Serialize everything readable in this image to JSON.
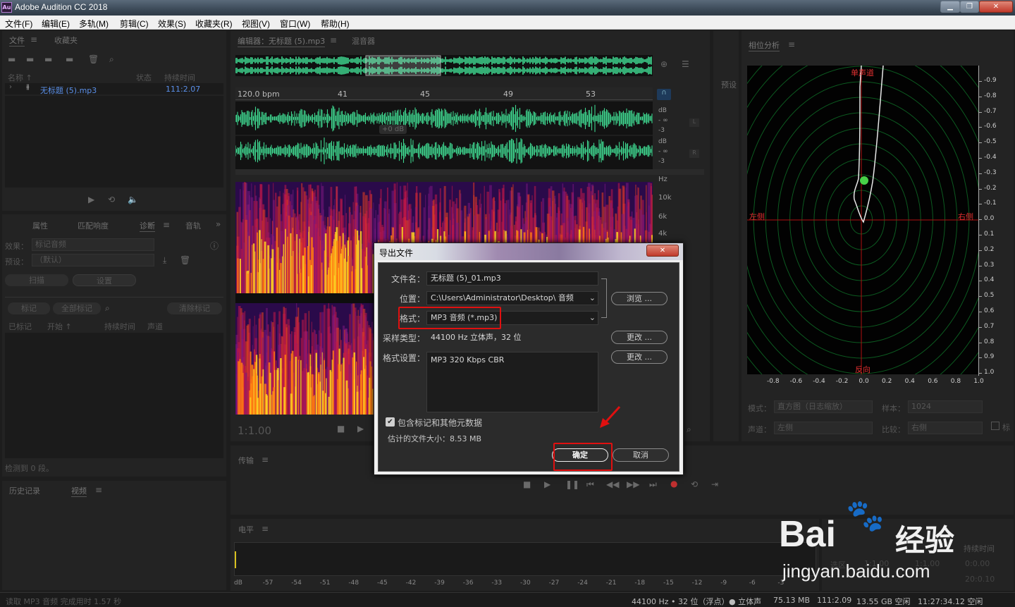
{
  "window": {
    "title": "Adobe Audition CC 2018",
    "icon_text": "Au",
    "min": "▁",
    "restore": "❐",
    "close": "✕"
  },
  "menu": [
    "文件(F)",
    "编辑(E)",
    "多轨(M)",
    "剪辑(C)",
    "效果(S)",
    "收藏夹(R)",
    "视图(V)",
    "窗口(W)",
    "帮助(H)"
  ],
  "files_panel": {
    "tabs": [
      "文件",
      "收藏夹"
    ],
    "columns": [
      "名称 ↑",
      "状态",
      "持续时间"
    ],
    "file_name": "无标题 (5).mp3",
    "file_duration": "111:2.07"
  },
  "diagnostics_panel": {
    "tabs": [
      "属性",
      "匹配响度",
      "诊断",
      "音轨"
    ],
    "effect_label": "效果：",
    "effect_value": "标记音频",
    "preset_label": "预设：",
    "preset_value": "（默认）",
    "scan": "扫描",
    "settings": "设置",
    "mark": "标记",
    "mark_all": "全部标记",
    "clear_marks": "清除标记",
    "cols": [
      "已标记",
      "开始 ↑",
      "持续时间",
      "声道"
    ],
    "detected": "检测到 0 段。"
  },
  "history_panel": {
    "tabs": [
      "历史记录",
      "视频"
    ]
  },
  "editor": {
    "tab_editor": "编辑器：无标题 (5).mp3",
    "tab_mixer": "混音器",
    "bpm": "120.0 bpm",
    "beats": [
      "41",
      "45",
      "49",
      "53"
    ],
    "db_labels": [
      "dB",
      "- ∞",
      "-3",
      "dB",
      "- ∞",
      "-3"
    ],
    "channels": [
      "L",
      "R"
    ],
    "hz": [
      "Hz",
      "10k",
      "6k",
      "4k"
    ],
    "gain": "+0 dB",
    "time": "1:1.00"
  },
  "presets_tab": "预设",
  "phase": {
    "title": "相位分析",
    "top": "单声道",
    "left": "左侧",
    "right": "右侧",
    "bottom": "反向",
    "right_scale": [
      "-0.9",
      "-0.8",
      "-0.7",
      "-0.6",
      "-0.5",
      "-0.4",
      "-0.3",
      "-0.2",
      "-0.1",
      "0.0",
      "0.1",
      "0.2",
      "0.3",
      "0.4",
      "0.5",
      "0.6",
      "0.7",
      "0.8",
      "0.9",
      "1.0"
    ],
    "bottom_scale": [
      "-0.8",
      "-0.6",
      "-0.4",
      "-0.2",
      "0.0",
      "0.2",
      "0.4",
      "0.6",
      "0.8",
      "1.0"
    ],
    "mode_label": "模式：",
    "mode_value": "直方图（日志缩放）",
    "sample_label": "样本：",
    "sample_value": "1024",
    "channel_label": "声道：",
    "channel_value": "左侧",
    "compare_label": "比较：",
    "compare_value": "右侧",
    "mark_label": "标"
  },
  "transport": {
    "title": "传输"
  },
  "levels": {
    "title": "电平",
    "scale": [
      "dB",
      "-57",
      "-54",
      "-51",
      "-48",
      "-45",
      "-42",
      "-39",
      "-36",
      "-33",
      "-30",
      "-27",
      "-24",
      "-21",
      "-18",
      "-15",
      "-12",
      "-9",
      "-6",
      "-3"
    ]
  },
  "selection": {
    "label_duration": "持续时间",
    "row1": [
      "选区",
      "1:1.00",
      "1:1.00",
      "0:0.00"
    ],
    "row2": "20:0.10"
  },
  "dialog": {
    "title": "导出文件",
    "close": "✕",
    "filename_label": "文件名：",
    "filename": "无标题 (5)_01.mp3",
    "location_label": "位置：",
    "location": "C:\\Users\\Administrator\\Desktop\\ 音频",
    "browse": "浏览 ...",
    "format_label": "格式：",
    "format": "MP3 音频 (*.mp3)",
    "sample_label": "采样类型：",
    "sample": "44100 Hz 立体声，32 位",
    "change1": "更改 ...",
    "settings_label": "格式设置：",
    "settings": "MP3 320 Kbps CBR",
    "change2": "更改 ...",
    "include_meta": "包含标记和其他元数据",
    "estimate": "估计的文件大小：8.53 MB",
    "ok": "确定",
    "cancel": "取消",
    "accent_red": "#e01010"
  },
  "watermark": {
    "brand": "Bai",
    "brand2": "经验",
    "url": "jingyan.baidu.com"
  },
  "status": {
    "left": "读取 MP3 音频 完成用时 1.57 秒",
    "sr": "44100 Hz • 32 位（浮点）",
    "ch": "● 立体声",
    "size": "75.13 MB",
    "dur": "111:2.09",
    "free": "13.55 GB 空闲",
    "free2": "11:27:34.12 空闲"
  }
}
